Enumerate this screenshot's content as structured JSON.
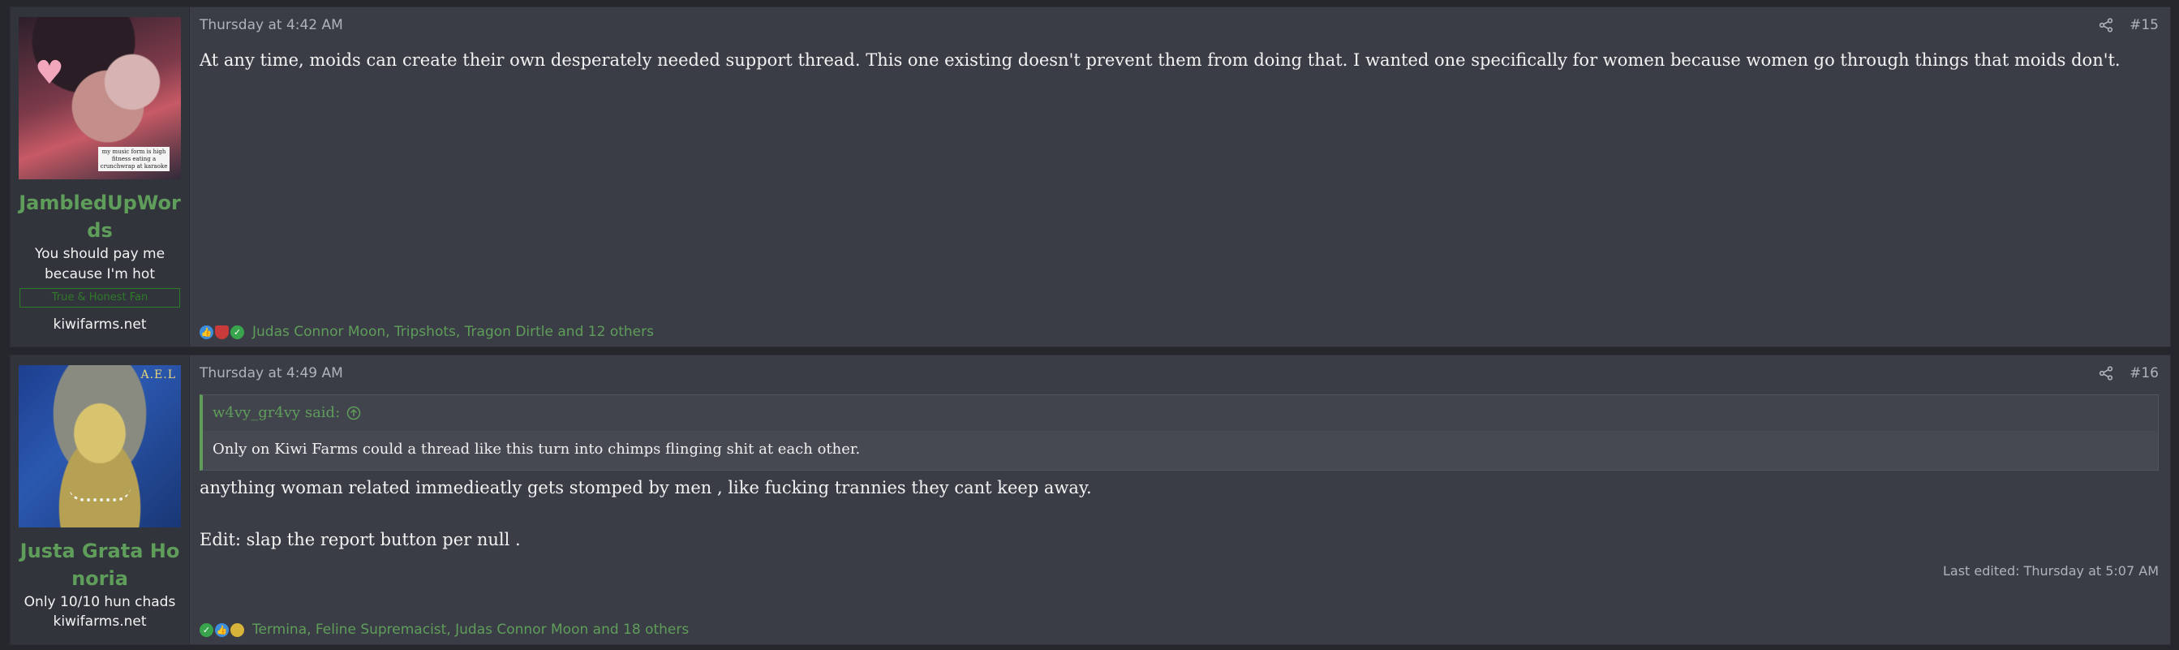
{
  "posts": [
    {
      "username": "JambledUpWords",
      "user_title": "You should pay me because I'm hot",
      "banner": "True & Honest Fan",
      "site": "kiwifarms.net",
      "avatar_caption": "my music form is high fitness eating a crunchwrap at karaoke",
      "date": "Thursday at 4:42 AM",
      "number": "#15",
      "body": "At any time, moids can create their own desperately needed support thread. This one existing doesn't prevent them from doing that. I wanted one specifically for women because women go through things that moids don't.",
      "reactions": "Judas Connor Moon, Tripshots, Tragon Dirtle and 12 others",
      "reaction_icons": [
        "like-icon",
        "shield-icon",
        "check-icon"
      ]
    },
    {
      "username": "Justa Grata Honoria",
      "user_title": "Only 10/10 hun chads",
      "site": "kiwifarms.net",
      "avatar_caption": "A.E.L",
      "date": "Thursday at 4:49 AM",
      "number": "#16",
      "quote_author": "w4vy_gr4vy said:",
      "quote_body": "Only on Kiwi Farms could a thread like this turn into chimps flinging shit at each other.",
      "body_line1": "anything woman related immedieatly gets stomped by men , like fucking trannies they cant keep away.",
      "body_line2": "Edit: slap the report button per null .",
      "edited": "Last edited: Thursday at 5:07 AM",
      "reactions": "Termina, Feline Supremacist, Judas Connor Moon and 18 others",
      "reaction_icons": [
        "check-icon",
        "like-icon",
        "medal-icon"
      ]
    }
  ],
  "colors": {
    "accent_green": "#5f9d5a",
    "post_bg": "#3a3d45",
    "user_cell_bg": "#31343b",
    "meta_text": "#aeb3bb"
  }
}
